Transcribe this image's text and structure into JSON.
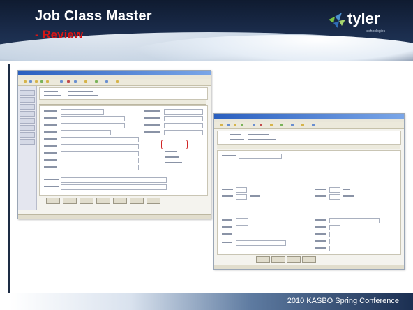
{
  "header": {
    "title": "Job Class Master",
    "subtitle": "- Review"
  },
  "logo": {
    "name": "tyler",
    "tagline": "technologies"
  },
  "footer": {
    "text": "2010 KASBO Spring Conference"
  },
  "colors": {
    "banner_dark": "#0f1b30",
    "title_white": "#ffffff",
    "subtitle_red": "#d81515",
    "logo_green": "#7ac143",
    "logo_blue": "#4a8fd0"
  },
  "screenshots": [
    {
      "name": "job-class-master-screen-1"
    },
    {
      "name": "job-class-master-screen-2"
    }
  ]
}
